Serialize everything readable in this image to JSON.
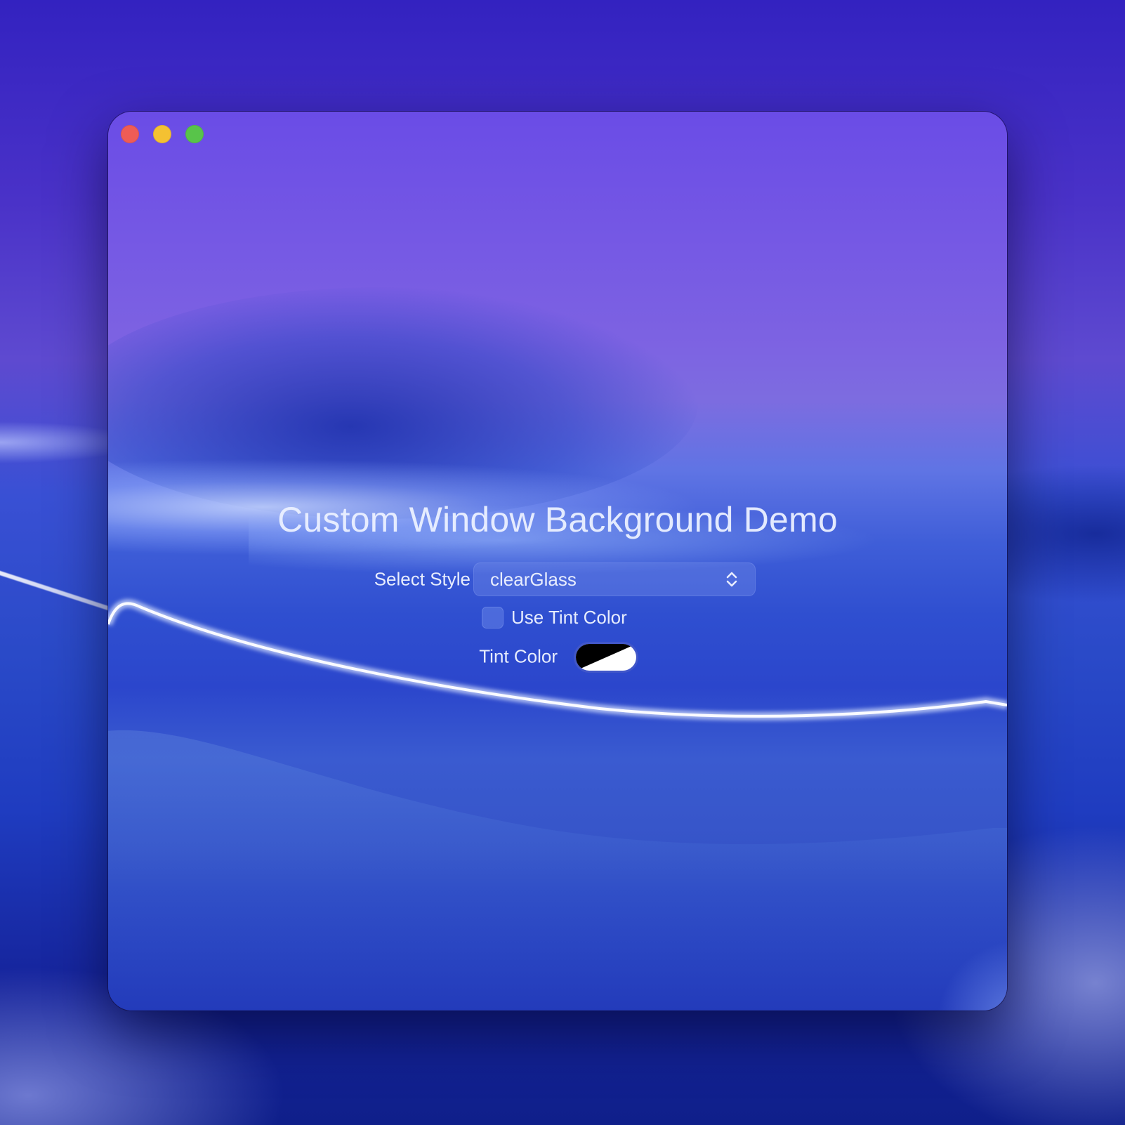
{
  "window": {
    "title": "Custom Window Background Demo",
    "traffic_lights": {
      "close_color": "#ee5c56",
      "minimize_color": "#f4c132",
      "maximize_color": "#58c44a"
    }
  },
  "form": {
    "style_label": "Select Style",
    "style_value": "clearGlass",
    "style_icon": "chevron-up-down-icon",
    "use_tint_label": "Use Tint Color",
    "use_tint_checked": false,
    "tint_label": "Tint Color",
    "tint_swatch": {
      "colors": [
        "#000000",
        "#ffffff"
      ]
    }
  }
}
